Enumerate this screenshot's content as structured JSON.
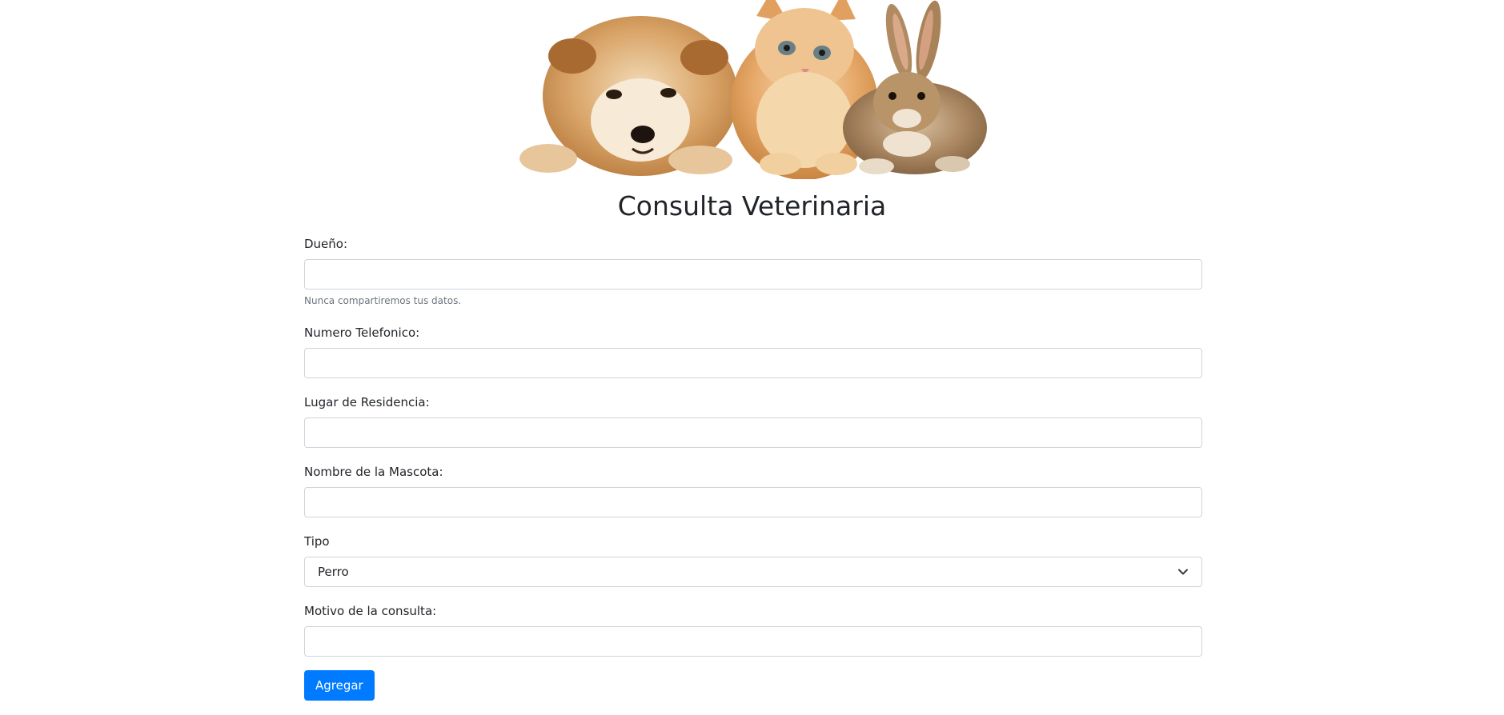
{
  "hero": {
    "image_name": "pets-banner-image",
    "animals": [
      "dog",
      "kitten",
      "rabbit"
    ]
  },
  "page_title": "Consulta Veterinaria",
  "form": {
    "owner": {
      "label": "Dueño:",
      "value": "",
      "help": "Nunca compartiremos tus datos."
    },
    "phone": {
      "label": "Numero Telefonico:",
      "value": ""
    },
    "residence": {
      "label": "Lugar de Residencia:",
      "value": ""
    },
    "pet_name": {
      "label": "Nombre de la Mascota:",
      "value": ""
    },
    "type": {
      "label": "Tipo",
      "selected": "Perro",
      "icon": "chevron-down-icon"
    },
    "reason": {
      "label": "Motivo de la consulta:",
      "value": ""
    },
    "submit_label": "Agregar"
  },
  "colors": {
    "primary": "#007bff",
    "text": "#212529",
    "muted": "#6c757d",
    "border": "#ced4da"
  }
}
